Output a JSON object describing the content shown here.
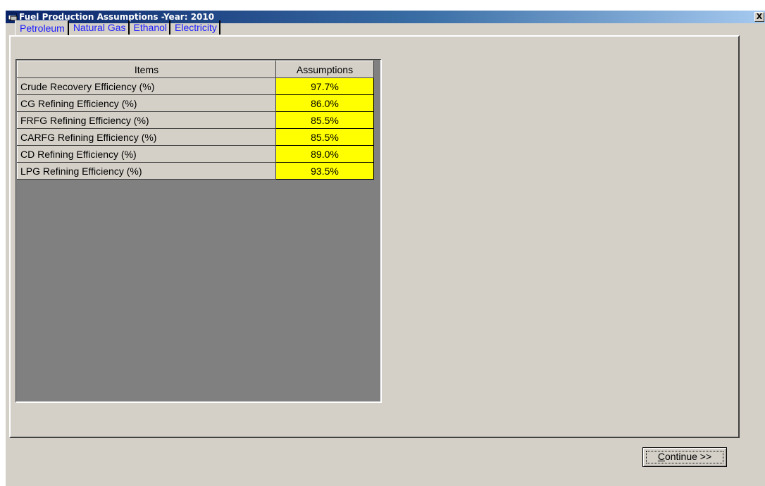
{
  "window": {
    "title": "Fuel Production Assumptions -Year: 2010",
    "close_label": "X"
  },
  "tabs": [
    {
      "label": "Petroleum",
      "active": true
    },
    {
      "label": "Natural Gas",
      "active": false
    },
    {
      "label": "Ethanol",
      "active": false
    },
    {
      "label": "Electricity",
      "active": false
    }
  ],
  "grid": {
    "columns": [
      "Items",
      "Assumptions"
    ],
    "rows": [
      {
        "item": "Crude Recovery Efficiency (%)",
        "value": "97.7%"
      },
      {
        "item": "CG Refining Efficiency (%)",
        "value": "86.0%"
      },
      {
        "item": "FRFG Refining Efficiency (%)",
        "value": "85.5%"
      },
      {
        "item": "CARFG Refining Efficiency (%)",
        "value": "85.5%"
      },
      {
        "item": "CD Refining Efficiency (%)",
        "value": "89.0%"
      },
      {
        "item": "LPG Refining Efficiency (%)",
        "value": "93.5%"
      }
    ]
  },
  "buttons": {
    "continue_label": "Continue >>"
  },
  "colors": {
    "titlebar_start": "#0a246a",
    "titlebar_end": "#a6caf0",
    "tab_text": "#1a1aff",
    "cell_highlight": "#ffff00",
    "grid_background": "#808080",
    "dialog_face": "#d4d0c8"
  },
  "icons": {
    "title": "app-window-icon",
    "close": "close-icon"
  }
}
